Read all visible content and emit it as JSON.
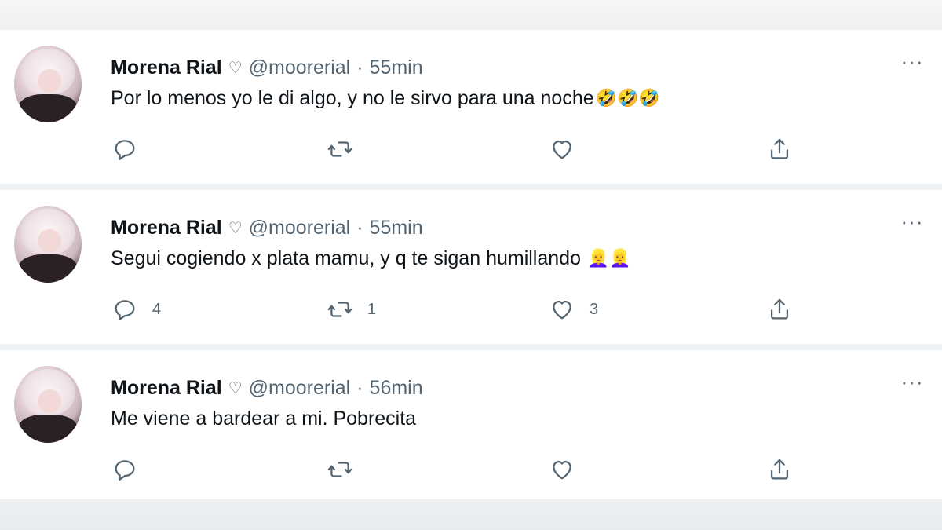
{
  "tweets": [
    {
      "name": "Morena Rial",
      "badge_icon": "heart-outline-icon",
      "handle": "@moorerial",
      "separator": "·",
      "time": "55min",
      "text": "Por lo menos yo le di algo, y no le sirvo para una noche",
      "emoji": "🤣🤣🤣",
      "reply_count": "",
      "retweet_count": "",
      "like_count": ""
    },
    {
      "name": "Morena Rial",
      "badge_icon": "heart-outline-icon",
      "handle": "@moorerial",
      "separator": "·",
      "time": "55min",
      "text": "Segui cogiendo x plata mamu, y q te sigan humillando ",
      "emoji": "👱‍♀️👱‍♀️",
      "reply_count": "4",
      "retweet_count": "1",
      "like_count": "3"
    },
    {
      "name": "Morena Rial",
      "badge_icon": "heart-outline-icon",
      "handle": "@moorerial",
      "separator": "·",
      "time": "56min",
      "text": "Me viene a bardear a mi. Pobrecita",
      "emoji": "",
      "reply_count": "",
      "retweet_count": "",
      "like_count": ""
    }
  ],
  "more_label": "···",
  "badge_glyph": "♡",
  "colors": {
    "text": "#0f1419",
    "muted": "#536471",
    "background": "#ffffff",
    "divider": "#eef1f3"
  }
}
